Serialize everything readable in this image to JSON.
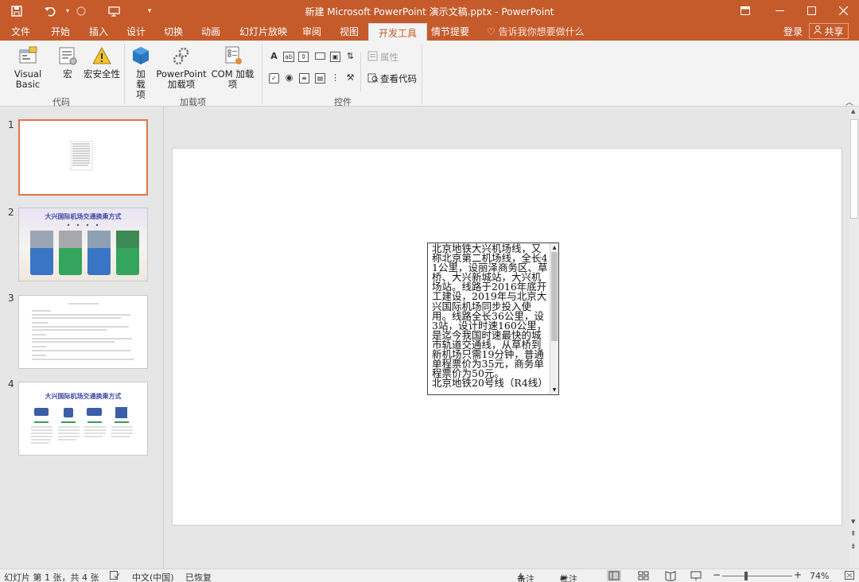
{
  "titlebar": {
    "title": "新建 Microsoft PowerPoint 演示文稿.pptx - PowerPoint",
    "save_icon": "save-icon",
    "undo_icon": "undo-icon",
    "redo_icon": "redo-icon",
    "customize_icon": "customize-qat-icon"
  },
  "tabs": [
    "文件",
    "开始",
    "插入",
    "设计",
    "切换",
    "动画",
    "幻灯片放映",
    "审阅",
    "视图",
    "开发工具",
    "情节提要"
  ],
  "active_tab": "开发工具",
  "tell_me": "告诉我你想要做什么",
  "login": "登录",
  "share": "共享",
  "ribbon": {
    "code": {
      "label": "代码",
      "visual_basic": "Visual Basic",
      "macro": "宏",
      "macro_security": "宏安全性"
    },
    "addins": {
      "label": "加载项",
      "add": "加载项",
      "ppt_addin_line1": "PowerPoint",
      "ppt_addin_line2": "加载项",
      "com_addin": "COM 加载项"
    },
    "controls": {
      "label": "控件",
      "properties": "属性",
      "view_code": "查看代码"
    }
  },
  "slides": {
    "numbers": [
      "1",
      "2",
      "3",
      "4"
    ],
    "slide2_title": "大兴国际机场交通换乘方式",
    "slide4_title": "大兴国际机场交通换乘方式"
  },
  "slide_textbox": {
    "text": "北京地铁大兴机场线，又称北京第二机场线，全长41公里，设丽泽商务区、草桥、大兴新城站，大兴机场站。线路于2016年底开工建设，2019年与北京大兴国际机场同步投入使用。线路全长36公里，设3站，设计时速160公里，是迄今我国时速最快的城市轨道交通线，从草桥到新机场只需19分钟，普通单程票价为35元，商务单程票价为50元。\n北京地铁20号线（R4线）"
  },
  "status": {
    "slide_info": "幻灯片 第 1 张，共 4 张",
    "language": "中文(中国)",
    "recovered": "已恢复",
    "notes": "备注",
    "comments": "批注",
    "zoom": "74%",
    "zoom_value": 0.74
  },
  "colors": {
    "accent": "#c55a2b",
    "ribbon_bg": "#f3f3f3",
    "selected_thumb": "#e0754a"
  }
}
